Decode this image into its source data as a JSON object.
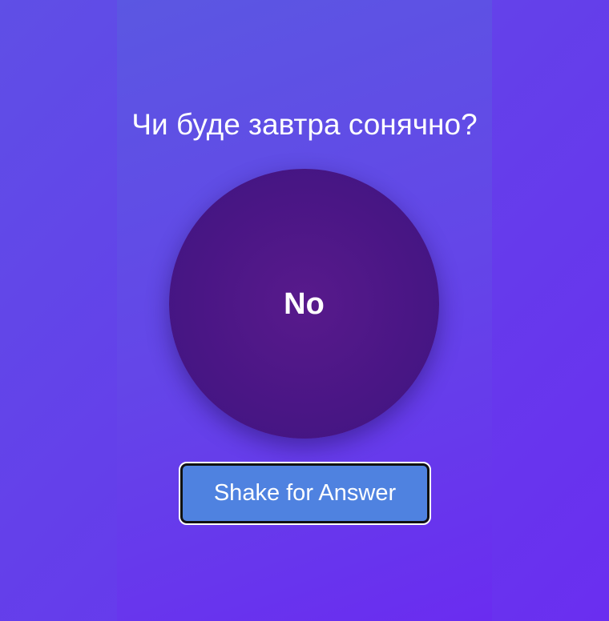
{
  "app": {
    "question": "Чи буде завтра сонячно?",
    "answer": "No",
    "shake_button_label": "Shake for Answer"
  },
  "colors": {
    "background_accent": "#6440ea",
    "ball": "#4a1685",
    "button": "#4f82e0",
    "text": "#ffffff"
  }
}
